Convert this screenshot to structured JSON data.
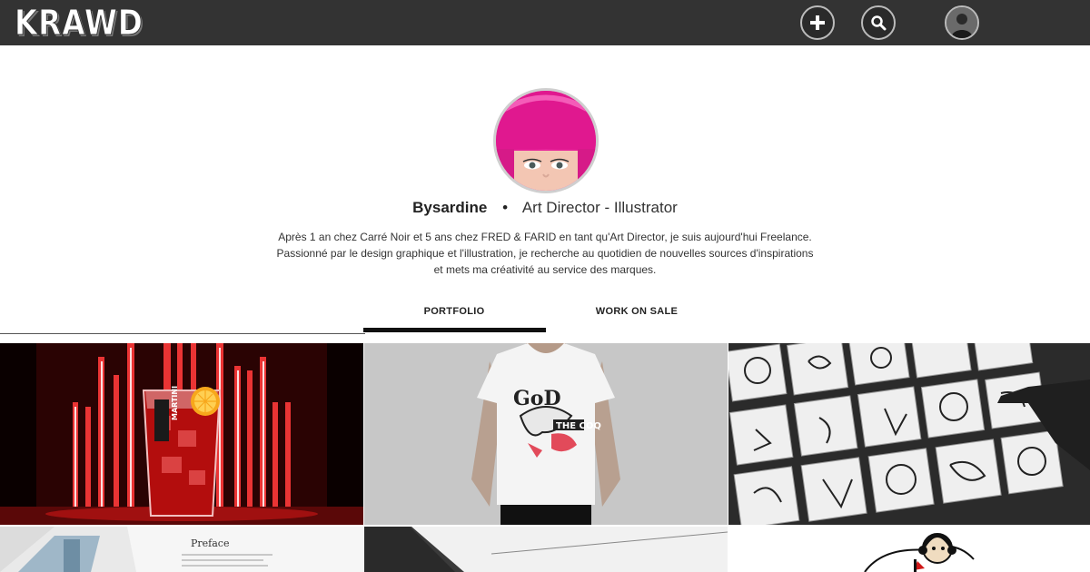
{
  "header": {
    "logo": "KRAWD",
    "add_icon": "plus-icon",
    "search_icon": "search-icon",
    "user_avatar": "user-avatar"
  },
  "profile": {
    "name": "Bysardine",
    "separator": "•",
    "role": "Art Director - Illustrator",
    "bio": [
      "Après 1 an chez Carré Noir et 5 ans chez FRED & FARID en tant qu'Art Director, je suis aujourd'hui Freelance.",
      "Passionné par le design graphique et l'illustration, je recherche au quotidien de nouvelles sources d'inspirations",
      "et mets ma créativité au service des marques."
    ]
  },
  "tabs": {
    "active": "PORTFOLIO",
    "items": [
      "PORTFOLIO",
      "WORK ON SALE"
    ]
  },
  "portfolio": {
    "tiles": [
      {
        "subject": "Martini glass with red neon lights",
        "label": "MARTINI"
      },
      {
        "subject": "Man wearing printed white t-shirt",
        "label": "THE COQ"
      },
      {
        "subject": "Ink illustrations laid on table"
      },
      {
        "subject": "Open book with perfume bottles",
        "label": "Preface"
      },
      {
        "subject": "Black and white sketch"
      },
      {
        "subject": "Pug with headphones illustration"
      }
    ]
  },
  "colors": {
    "topbar": "#333333",
    "accent_pink": "#e8259a",
    "neon_red": "#e01515"
  }
}
